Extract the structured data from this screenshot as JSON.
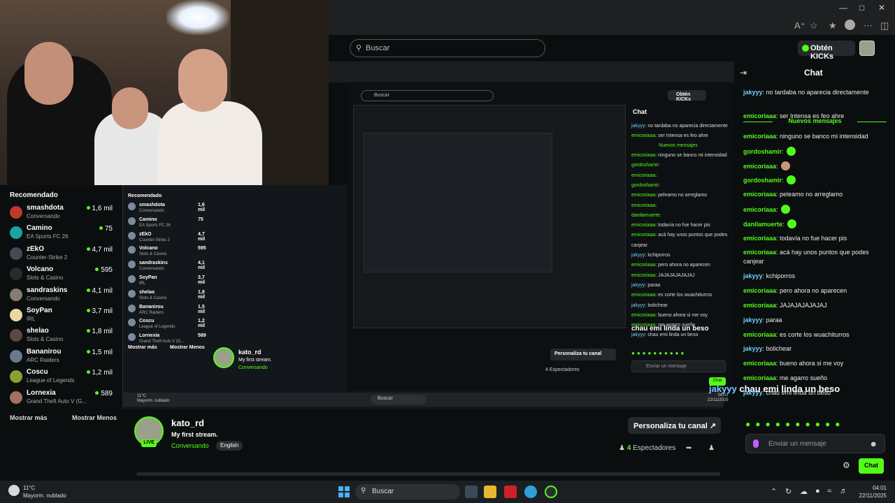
{
  "browser": {
    "search_placeholder": "Buscar",
    "kicks_label": "Obtén KICKs"
  },
  "sidebar": {
    "title": "Recomendado",
    "items": [
      {
        "name": "smashdota",
        "category": "Conversando",
        "viewers": "1,6 mil",
        "color": "#c0392b"
      },
      {
        "name": "Camino",
        "category": "EA Sports FC 26",
        "viewers": "75",
        "color": "#1aa3a3"
      },
      {
        "name": "zEkO",
        "category": "Counter-Strike 2",
        "viewers": "4,7 mil",
        "color": "#444a55"
      },
      {
        "name": "Volcano",
        "category": "Slots & Casino",
        "viewers": "595",
        "color": "#2b2b2b"
      },
      {
        "name": "sandraskins",
        "category": "Conversando",
        "viewers": "4,1 mil",
        "color": "#8a7a70"
      },
      {
        "name": "SoyPan",
        "category": "IRL",
        "viewers": "3,7 mil",
        "color": "#e8d9a0"
      },
      {
        "name": "shelao",
        "category": "Slots & Casino",
        "viewers": "1,8 mil",
        "color": "#5a4a40"
      },
      {
        "name": "Bananirou",
        "category": "ARC Raiders",
        "viewers": "1,5 mil",
        "color": "#6a7a8a"
      },
      {
        "name": "Coscu",
        "category": "League of Legends",
        "viewers": "1,2 mil",
        "color": "#8aa030"
      },
      {
        "name": "Lornexia",
        "category": "Grand Theft Auto V (G...",
        "viewers": "589",
        "color": "#a07060"
      }
    ],
    "show_more": "Mostrar más",
    "show_less": "Mostrar Menos"
  },
  "nested": {
    "chat_title": "Chat",
    "nuevos": "Nuevos mensajes",
    "search": "Buscar",
    "kicks": "Obtén KICKs",
    "recommended": "Recomendado",
    "name": "kato_rd",
    "subtitle": "My first stream.",
    "category": "Conversando",
    "persona": "Personaliza tu canal",
    "viewers": "4 Espectadores",
    "input": "Enviar un mensaje",
    "chat_btn": "Chat",
    "big_line": "chau emi linda un beso",
    "weather": "11°C",
    "weather2": "Mayorm. nublado",
    "time": "04:01",
    "date": "22/11/2025",
    "lines": [
      {
        "user": "jakyyy",
        "text": "no tardaba no aparecia directamente",
        "c": "b"
      },
      {
        "user": "emicoriaaa",
        "text": "ser Intensa es feo ahre",
        "c": "g"
      },
      {
        "user": "emicoriaaa",
        "text": "ninguno se banco mi intensidad",
        "c": "g"
      },
      {
        "user": "gordoshamir",
        "text": "",
        "c": "g"
      },
      {
        "user": "emicoriaaa",
        "text": "",
        "c": "g"
      },
      {
        "user": "gordoshamir",
        "text": "",
        "c": "g"
      },
      {
        "user": "emicoriaaa",
        "text": "peleamo no arreglamo",
        "c": "g"
      },
      {
        "user": "emicoriaaa",
        "text": "",
        "c": "g"
      },
      {
        "user": "danilamuerte",
        "text": "",
        "c": "g"
      },
      {
        "user": "emicoriaaa",
        "text": "todavía no fue hacer pis",
        "c": "g"
      },
      {
        "user": "emicoriaaa",
        "text": "acá hay unos puntos que podes",
        "c": "g"
      },
      {
        "user": "",
        "text": "canjear",
        "c": "g"
      },
      {
        "user": "jakyyy",
        "text": "kchiporros",
        "c": "b"
      },
      {
        "user": "emicoriaaa",
        "text": "pero ahora no aparecen",
        "c": "g"
      },
      {
        "user": "emicoriaaa",
        "text": "JAJAJAJAJAJAJ",
        "c": "g"
      },
      {
        "user": "jakyyy",
        "text": "paraa",
        "c": "b"
      },
      {
        "user": "emicoriaaa",
        "text": "es corte los wuachiturros",
        "c": "g"
      },
      {
        "user": "jakyyy",
        "text": "bolichear",
        "c": "b"
      },
      {
        "user": "emicoriaaa",
        "text": "bueno ahora si me voy",
        "c": "g"
      },
      {
        "user": "emicoriaaa",
        "text": "me agarro sueño",
        "c": "g"
      },
      {
        "user": "jakyyy",
        "text": "chau emi linda un beso",
        "c": "b"
      }
    ],
    "sb_items": [
      {
        "name": "smashdota",
        "cat": "Conversando",
        "v": "1,6 mil"
      },
      {
        "name": "Camino",
        "cat": "EA Sports FC 26",
        "v": "75"
      },
      {
        "name": "zEkO",
        "cat": "Counter-Strike 2",
        "v": "4,7 mil"
      },
      {
        "name": "Volcano",
        "cat": "Slots & Casino",
        "v": "595"
      },
      {
        "name": "sandraskins",
        "cat": "Conversando",
        "v": "4,1 mil"
      },
      {
        "name": "SoyPan",
        "cat": "IRL",
        "v": "3,7 mil"
      },
      {
        "name": "shelao",
        "cat": "Slots & Casino",
        "v": "1,8 mil"
      },
      {
        "name": "Bananirou",
        "cat": "ARC Raiders",
        "v": "1,5 mil"
      },
      {
        "name": "Coscu",
        "cat": "League of Legends",
        "v": "1,2 mil"
      },
      {
        "name": "Lornexia",
        "cat": "Grand Theft Auto V (G...",
        "v": "589"
      }
    ],
    "sb_more": "Mostrar más",
    "sb_less": "Mostrar Menos"
  },
  "channel": {
    "name": "kato_rd",
    "subtitle": "My first stream.",
    "category": "Conversando",
    "language": "English",
    "live": "LIVE",
    "customize": "Personaliza tu canal",
    "viewers_count": "4",
    "viewers_label": "Espectadores"
  },
  "chat": {
    "title": "Chat",
    "nuevos": "Nuevos mensajes",
    "messages_before": [
      {
        "user": "jakyyy",
        "text": "no tardaba no aparecia directamente",
        "color": "blue"
      },
      {
        "user": "emicoriaaa",
        "text": "ser Intensa es feo ahre",
        "color": "green"
      }
    ],
    "messages": [
      {
        "user": "emicoriaaa",
        "text": "ninguno se banco mi intensidad",
        "color": "green",
        "emote": ""
      },
      {
        "user": "gordoshamir",
        "text": "",
        "color": "green",
        "emote": "g"
      },
      {
        "user": "emicoriaaa",
        "text": "",
        "color": "green",
        "emote": "f"
      },
      {
        "user": "gordoshamir",
        "text": "",
        "color": "green",
        "emote": "g"
      },
      {
        "user": "emicoriaaa",
        "text": "peleamo no arreglamo",
        "color": "green",
        "emote": ""
      },
      {
        "user": "emicoriaaa",
        "text": "",
        "color": "green",
        "emote": "g"
      },
      {
        "user": "danilamuerte",
        "text": "",
        "color": "green",
        "emote": "g"
      },
      {
        "user": "emicoriaaa",
        "text": "todavía no fue hacer pis",
        "color": "green",
        "emote": ""
      },
      {
        "user": "emicoriaaa",
        "text": "acá hay unos puntos que podes canjear",
        "color": "green",
        "emote": ""
      },
      {
        "user": "jakyyy",
        "text": "kchiporros",
        "color": "blue",
        "emote": ""
      },
      {
        "user": "emicoriaaa",
        "text": "pero ahora no aparecen",
        "color": "green",
        "emote": ""
      },
      {
        "user": "emicoriaaa",
        "text": "JAJAJAJAJAJAJ",
        "color": "green",
        "emote": ""
      },
      {
        "user": "jakyyy",
        "text": "paraa",
        "color": "blue",
        "emote": ""
      },
      {
        "user": "emicoriaaa",
        "text": "es corte los wuachiturros",
        "color": "green",
        "emote": ""
      },
      {
        "user": "jakyyy",
        "text": "bolichear",
        "color": "blue",
        "emote": ""
      },
      {
        "user": "emicoriaaa",
        "text": "bueno ahora si me voy",
        "color": "green",
        "emote": ""
      },
      {
        "user": "emicoriaaa",
        "text": "me agarro sueño",
        "color": "green",
        "emote": ""
      },
      {
        "user": "jakyyy",
        "text": "chau emi linda un beso",
        "color": "blue",
        "emote": ""
      }
    ],
    "overlay_user": "jakyyy",
    "overlay_text": "chau emi linda un beso",
    "input_placeholder": "Enviar un mensaje",
    "send_label": "Chat"
  },
  "taskbar": {
    "temp": "11°C",
    "weather": "Mayorm. nublado",
    "search": "Buscar",
    "time": "04:01",
    "date": "22/11/2025"
  },
  "colors": {
    "accent": "#53fc18",
    "bg": "#0b0e0f",
    "username_blue": "#6fd0ff"
  }
}
